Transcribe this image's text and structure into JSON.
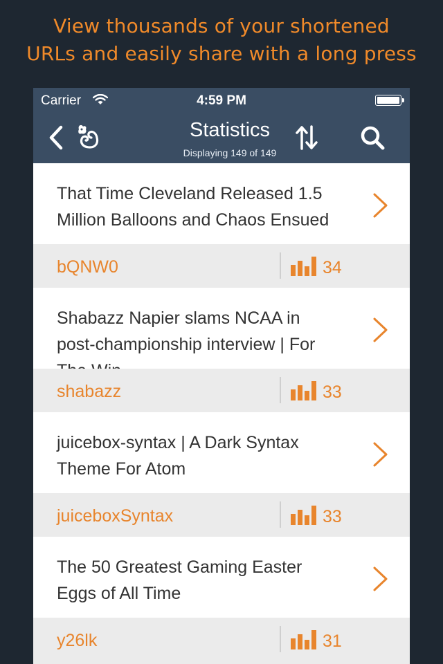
{
  "promo": {
    "line1": "View thousands of your shortened",
    "line2": "URLs and easily share with a long press"
  },
  "statusbar": {
    "carrier": "Carrier",
    "time": "4:59 PM",
    "wifi_icon": "wifi-icon",
    "battery_icon": "battery-icon"
  },
  "navbar": {
    "title": "Statistics",
    "subtitle": "Displaying 149 of 149",
    "back_icon": "chevron-left-icon",
    "logo_icon": "squirrel-logo-icon",
    "sort_icon": "sort-arrows-icon",
    "search_icon": "search-icon"
  },
  "colors": {
    "accent": "#e8852d",
    "navbar": "#3a4d63",
    "background": "#1e2731"
  },
  "items": [
    {
      "title": "That Time Cleveland Released 1.5 Million Balloons and Chaos Ensued",
      "slug": "bQNW0",
      "clicks": "34"
    },
    {
      "title": "Shabazz Napier slams NCAA in post-championship interview | For The Win",
      "slug": "shabazz",
      "clicks": "33"
    },
    {
      "title": "juicebox-syntax | A Dark Syntax Theme For Atom",
      "slug": "juiceboxSyntax",
      "clicks": "33"
    },
    {
      "title": "The 50 Greatest Gaming Easter Eggs of All Time",
      "slug": "y26lk",
      "clicks": "31"
    }
  ]
}
